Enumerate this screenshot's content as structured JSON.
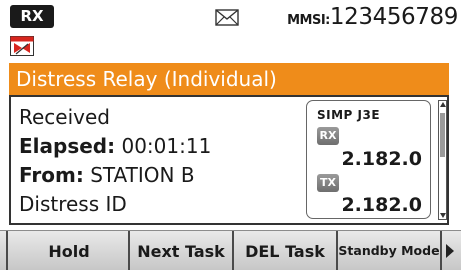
{
  "status_bar": {
    "rx_label": "RX",
    "envelope_icon": "envelope-icon",
    "mmsi_label": "MMSI:",
    "mmsi_value": "123456789"
  },
  "alert_icon": "distress-relay-icon",
  "title": "Distress Relay (Individual)",
  "info": {
    "status": "Received",
    "elapsed_label": "Elapsed:",
    "elapsed_value": "00:01:11",
    "from_label": "From:",
    "from_value": "STATION B",
    "category": "Distress ID"
  },
  "frequency_panel": {
    "mode": "SIMP J3E",
    "rx_tag": "RX",
    "rx_freq": "2.182.0",
    "tx_tag": "TX",
    "tx_freq": "2.182.0"
  },
  "softkeys": [
    {
      "label": "Hold"
    },
    {
      "label": "Next Task"
    },
    {
      "label": "DEL Task"
    },
    {
      "label": "Standby Mode"
    }
  ],
  "colors": {
    "title_bar": "#ef8c1a",
    "softkey_bar": "#d6d6d6",
    "badge": "#1a1a1a"
  }
}
